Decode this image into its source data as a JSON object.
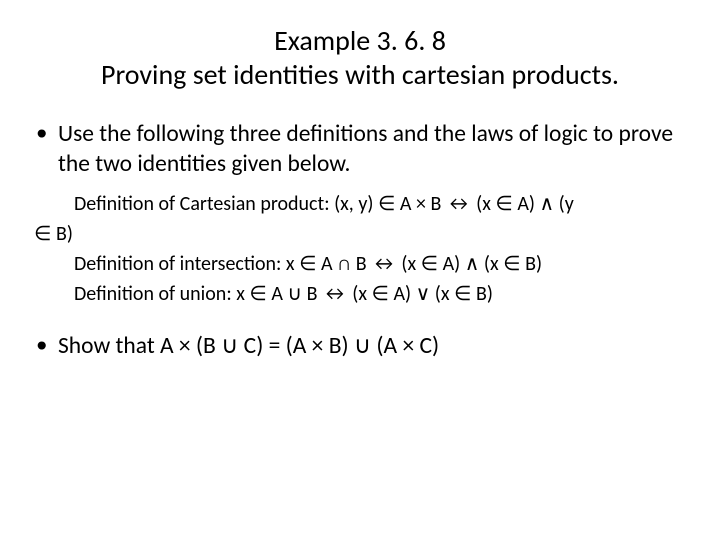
{
  "title": {
    "line1": "Example 3. 6. 8",
    "line2": "Proving set identities with cartesian products."
  },
  "bullets": {
    "b1": "Use the following three definitions and the laws of logic to prove the two identities given below.",
    "b2": "Show that A × (B ∪ C) = (A × B) ∪ (A × C)"
  },
  "definitions": {
    "cartesian_a": "Definition of Cartesian product: (x, y) ∈ A × B ↔ (x ∈ A) ∧ (y",
    "cartesian_b": "∈ B)",
    "intersection": "Definition of intersection: x ∈ A ∩ B ↔ (x ∈ A) ∧ (x ∈ B)",
    "union": "Definition of union: x ∈ A ∪ B ↔ (x ∈ A) ∨ (x ∈ B)"
  }
}
